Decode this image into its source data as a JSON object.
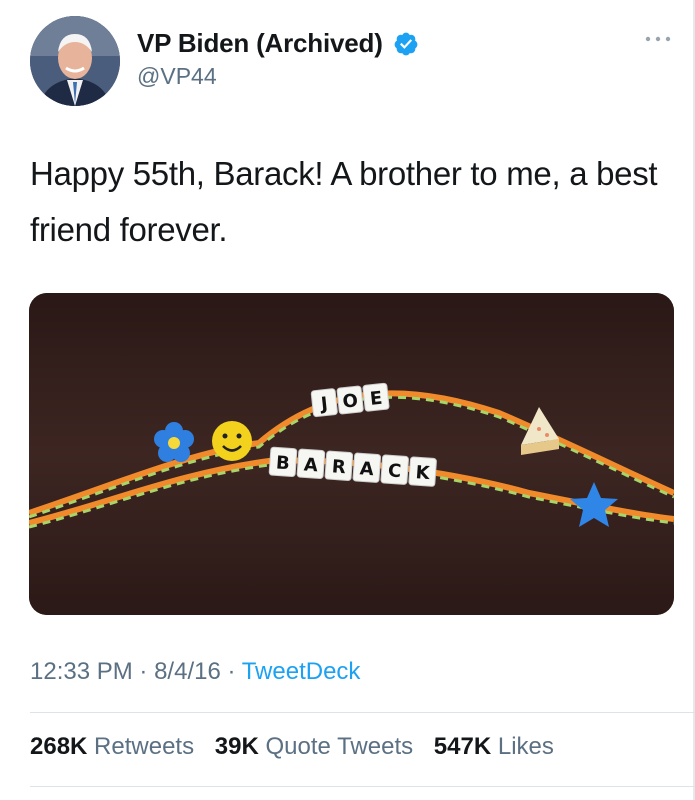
{
  "tweet": {
    "display_name": "VP Biden (Archived)",
    "handle": "@VP44",
    "text": "Happy 55th, Barack! A brother to me, a best friend forever.",
    "time": "12:33 PM",
    "date": "8/4/16",
    "separator": "·",
    "source": "TweetDeck"
  },
  "media": {
    "bead_words": [
      "JOE",
      "BARACK"
    ]
  },
  "stats": [
    {
      "count": "268K",
      "label": "Retweets"
    },
    {
      "count": "39K",
      "label": "Quote Tweets"
    },
    {
      "count": "547K",
      "label": "Likes"
    }
  ],
  "icons": {
    "verified": "verified-badge-icon",
    "more": "more-options-icon"
  },
  "colors": {
    "accent": "#1da1f2",
    "secondary_text": "#5b7083"
  }
}
